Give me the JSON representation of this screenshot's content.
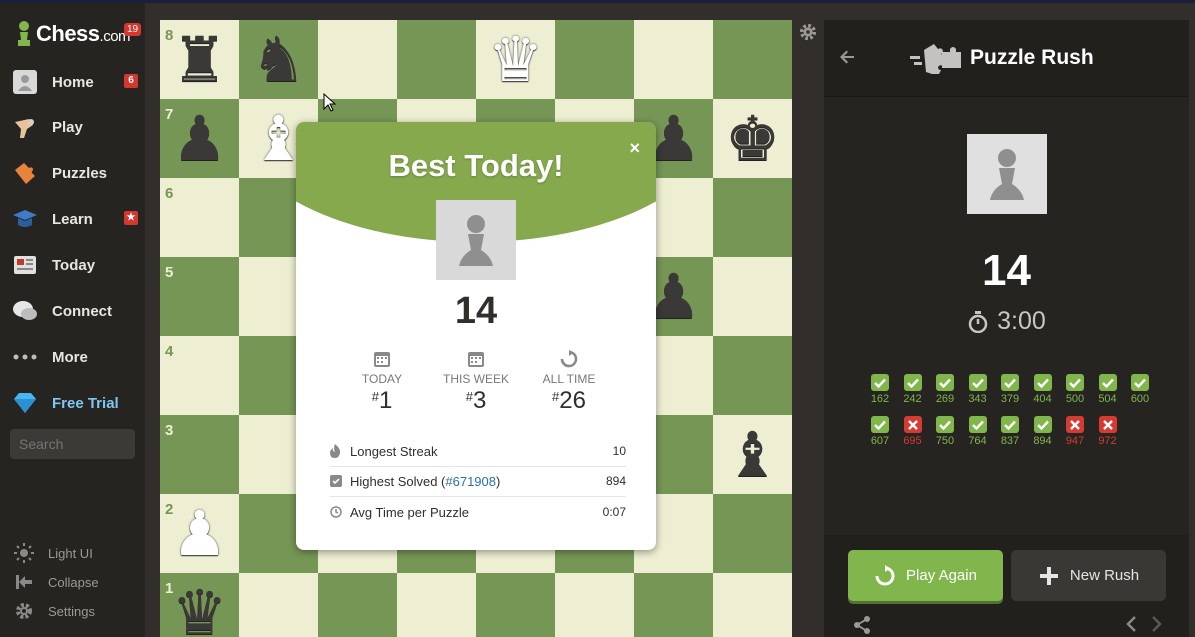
{
  "colors": {
    "accent_green": "#81b64c",
    "board_light": "#eeeed2",
    "board_dark": "#769656",
    "error_red": "#d33b33"
  },
  "logo": {
    "name": "Chess",
    "suffix": ".com",
    "badge": "19"
  },
  "sidebar": {
    "items": [
      {
        "label": "Home",
        "icon": "home-icon",
        "badge": "6"
      },
      {
        "label": "Play",
        "icon": "play-hand-icon"
      },
      {
        "label": "Puzzles",
        "icon": "puzzle-piece-icon"
      },
      {
        "label": "Learn",
        "icon": "graduation-cap-icon",
        "badge": "★"
      },
      {
        "label": "Today",
        "icon": "newspaper-icon"
      },
      {
        "label": "Connect",
        "icon": "chat-bubbles-icon"
      },
      {
        "label": "More",
        "icon": "more-dots-icon"
      },
      {
        "label": "Free Trial",
        "icon": "diamond-icon"
      }
    ],
    "search_placeholder": "Search",
    "bottom": [
      {
        "label": "Light UI",
        "icon": "sun-icon"
      },
      {
        "label": "Collapse",
        "icon": "collapse-icon"
      },
      {
        "label": "Settings",
        "icon": "gear-icon"
      }
    ]
  },
  "board": {
    "ranks": [
      "8",
      "7",
      "6",
      "5",
      "4",
      "3",
      "2",
      "1"
    ]
  },
  "modal": {
    "title": "Best Today!",
    "close": "×",
    "score": "14",
    "ranks": [
      {
        "label": "TODAY",
        "value": "1"
      },
      {
        "label": "THIS WEEK",
        "value": "3"
      },
      {
        "label": "ALL TIME",
        "value": "26"
      }
    ],
    "stats": [
      {
        "label": "Longest Streak",
        "value": "10"
      },
      {
        "label_prefix": "Highest Solved (",
        "link": "#671908",
        "label_suffix": ")",
        "value": "894"
      },
      {
        "label": "Avg Time per Puzzle",
        "value": "0:07"
      }
    ]
  },
  "panel": {
    "title": "Puzzle Rush",
    "score": "14",
    "timer": "3:00",
    "results": [
      {
        "value": "162",
        "ok": true
      },
      {
        "value": "242",
        "ok": true
      },
      {
        "value": "269",
        "ok": true
      },
      {
        "value": "343",
        "ok": true
      },
      {
        "value": "379",
        "ok": true
      },
      {
        "value": "404",
        "ok": true
      },
      {
        "value": "500",
        "ok": true
      },
      {
        "value": "504",
        "ok": true
      },
      {
        "value": "600",
        "ok": true
      },
      {
        "value": "607",
        "ok": true
      },
      {
        "value": "695",
        "ok": false
      },
      {
        "value": "750",
        "ok": true
      },
      {
        "value": "764",
        "ok": true
      },
      {
        "value": "837",
        "ok": true
      },
      {
        "value": "894",
        "ok": true
      },
      {
        "value": "947",
        "ok": false
      },
      {
        "value": "972",
        "ok": false
      }
    ],
    "play_again": "Play Again",
    "new_rush": "New Rush"
  }
}
